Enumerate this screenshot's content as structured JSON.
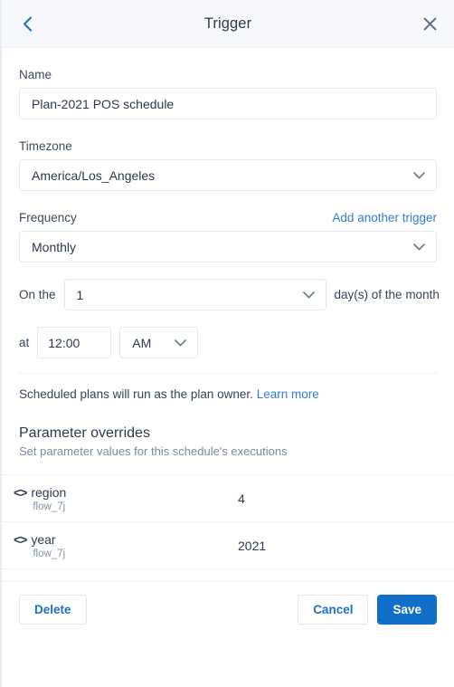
{
  "colors": {
    "accent": "#1070c9",
    "link": "#2f7ed1",
    "text": "#2b3a52",
    "muted": "#7b8aa6",
    "header_bg": "#f6f8fc",
    "border": "#e3e8f0"
  },
  "header": {
    "title": "Trigger",
    "back_icon": "chevron-left-icon",
    "close_icon": "close-icon"
  },
  "form": {
    "name": {
      "label": "Name",
      "value": "Plan-2021 POS schedule",
      "placeholder": "Name"
    },
    "timezone": {
      "label": "Timezone",
      "value": "America/Los_Angeles"
    },
    "frequency": {
      "label": "Frequency",
      "add_trigger_link": "Add another trigger",
      "value": "Monthly"
    },
    "day_of_month": {
      "prefix": "On the",
      "value": "1",
      "suffix": "day(s) of the month"
    },
    "time": {
      "prefix": "at",
      "value": "12:00",
      "placeholder": "12:00",
      "meridiem": "AM"
    },
    "note": {
      "text": "Scheduled plans will run as the plan owner.",
      "link": "Learn more"
    }
  },
  "overrides": {
    "title": "Parameter overrides",
    "subtitle": "Set parameter values for this schedule's executions",
    "icon": "code-brackets-icon",
    "rows": [
      {
        "icon_label": "<>",
        "name": "region",
        "source": "flow_7j",
        "value": "4"
      },
      {
        "icon_label": "<>",
        "name": "year",
        "source": "flow_7j",
        "value": "2021"
      }
    ]
  },
  "footer": {
    "delete_label": "Delete",
    "cancel_label": "Cancel",
    "save_label": "Save"
  }
}
